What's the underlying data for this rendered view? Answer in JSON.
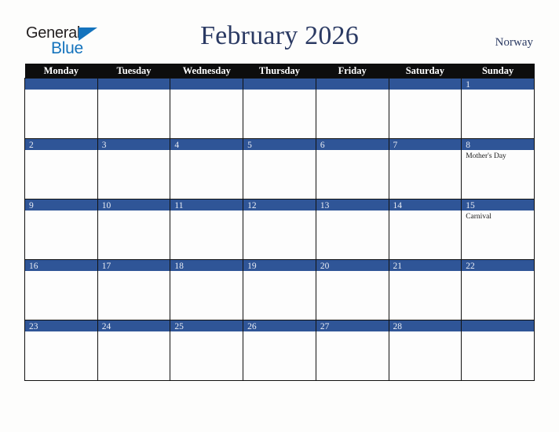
{
  "brand": {
    "logo_text_1": "General",
    "logo_text_2": "Blue",
    "triangle_icon": "triangle-icon",
    "accent_blue": "#1473bd"
  },
  "header": {
    "title": "February 2026",
    "region": "Norway",
    "title_color": "#2b3a63"
  },
  "theme": {
    "header_row_bg": "#0d0d0d",
    "day_band_bg": "#2f5597",
    "day_number_color": "#e8ecf4",
    "cell_bg": "#fdfdfd",
    "page_bg": "#fdfdfc",
    "grid_line": "#111111"
  },
  "weekdays": [
    {
      "label": "Monday"
    },
    {
      "label": "Tuesday"
    },
    {
      "label": "Wednesday"
    },
    {
      "label": "Thursday"
    },
    {
      "label": "Friday"
    },
    {
      "label": "Saturday"
    },
    {
      "label": "Sunday"
    }
  ],
  "weeks": [
    {
      "days": [
        {
          "num": "",
          "events": []
        },
        {
          "num": "",
          "events": []
        },
        {
          "num": "",
          "events": []
        },
        {
          "num": "",
          "events": []
        },
        {
          "num": "",
          "events": []
        },
        {
          "num": "",
          "events": []
        },
        {
          "num": "1",
          "events": []
        }
      ]
    },
    {
      "days": [
        {
          "num": "2",
          "events": []
        },
        {
          "num": "3",
          "events": []
        },
        {
          "num": "4",
          "events": []
        },
        {
          "num": "5",
          "events": []
        },
        {
          "num": "6",
          "events": []
        },
        {
          "num": "7",
          "events": []
        },
        {
          "num": "8",
          "events": [
            {
              "name": "Mother's Day"
            }
          ]
        }
      ]
    },
    {
      "days": [
        {
          "num": "9",
          "events": []
        },
        {
          "num": "10",
          "events": []
        },
        {
          "num": "11",
          "events": []
        },
        {
          "num": "12",
          "events": []
        },
        {
          "num": "13",
          "events": []
        },
        {
          "num": "14",
          "events": []
        },
        {
          "num": "15",
          "events": [
            {
              "name": "Carnival"
            }
          ]
        }
      ]
    },
    {
      "days": [
        {
          "num": "16",
          "events": []
        },
        {
          "num": "17",
          "events": []
        },
        {
          "num": "18",
          "events": []
        },
        {
          "num": "19",
          "events": []
        },
        {
          "num": "20",
          "events": []
        },
        {
          "num": "21",
          "events": []
        },
        {
          "num": "22",
          "events": []
        }
      ]
    },
    {
      "days": [
        {
          "num": "23",
          "events": []
        },
        {
          "num": "24",
          "events": []
        },
        {
          "num": "25",
          "events": []
        },
        {
          "num": "26",
          "events": []
        },
        {
          "num": "27",
          "events": []
        },
        {
          "num": "28",
          "events": []
        },
        {
          "num": "",
          "events": []
        }
      ]
    }
  ]
}
